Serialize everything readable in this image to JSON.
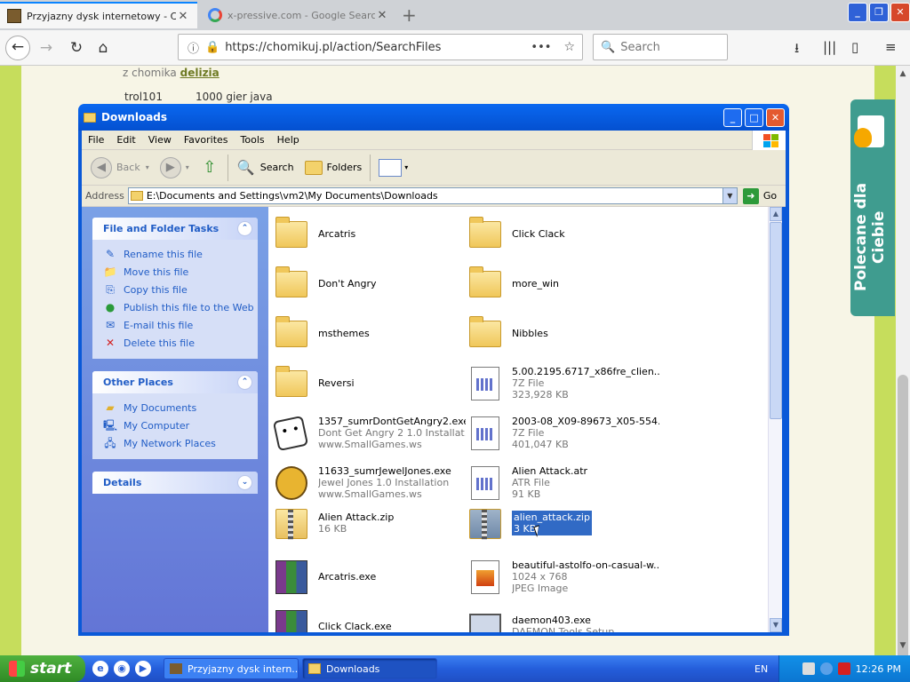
{
  "browser": {
    "tabs": [
      {
        "label": "Przyjazny dysk internetowy - Chomikuj.pl",
        "active": true
      },
      {
        "label": "x-pressive.com - Google Search",
        "active": false
      }
    ],
    "url": "https://chomikuj.pl/action/SearchFiles",
    "search_placeholder": "Search"
  },
  "page": {
    "from_prefix": "z chomika",
    "from_user": "delizia",
    "row_user": "trol101",
    "row_folder": "1000 gier java",
    "polecane": "Polecane dla Ciebie"
  },
  "explorer": {
    "title": "Downloads",
    "menu": [
      "File",
      "Edit",
      "View",
      "Favorites",
      "Tools",
      "Help"
    ],
    "toolbar": {
      "back": "Back",
      "search": "Search",
      "folders": "Folders"
    },
    "address_label": "Address",
    "address": "E:\\Documents and Settings\\vm2\\My Documents\\Downloads",
    "go": "Go",
    "tasks": {
      "title": "File and Folder Tasks",
      "items": [
        "Rename this file",
        "Move this file",
        "Copy this file",
        "Publish this file to the Web",
        "E-mail this file",
        "Delete this file"
      ]
    },
    "other_places": {
      "title": "Other Places",
      "items": [
        "My Documents",
        "My Computer",
        "My Network Places"
      ]
    },
    "details_title": "Details",
    "files": [
      {
        "name": "Arcatris",
        "l2": "",
        "l3": "",
        "icon": "folder"
      },
      {
        "name": "Click Clack",
        "l2": "",
        "l3": "",
        "icon": "folder"
      },
      {
        "name": "Don't Angry",
        "l2": "",
        "l3": "",
        "icon": "folder"
      },
      {
        "name": "more_win",
        "l2": "",
        "l3": "",
        "icon": "folder"
      },
      {
        "name": "msthemes",
        "l2": "",
        "l3": "",
        "icon": "folder"
      },
      {
        "name": "Nibbles",
        "l2": "",
        "l3": "",
        "icon": "folder"
      },
      {
        "name": "Reversi",
        "l2": "",
        "l3": "",
        "icon": "folder"
      },
      {
        "name": "5.00.2195.6717_x86fre_clien...",
        "l2": "7Z File",
        "l3": "323,928 KB",
        "icon": "file"
      },
      {
        "name": "1357_sumrDontGetAngry2.exe",
        "l2": "Dont Get Angry 2 1.0 Installat...",
        "l3": "www.SmallGames.ws",
        "icon": "dice"
      },
      {
        "name": "2003-08_X09-89673_X05-554...",
        "l2": "7Z File",
        "l3": "401,047 KB",
        "icon": "file"
      },
      {
        "name": "11633_sumrJewelJones.exe",
        "l2": "Jewel Jones 1.0 Installation",
        "l3": "www.SmallGames.ws",
        "icon": "face"
      },
      {
        "name": "Alien Attack.atr",
        "l2": "ATR File",
        "l3": "91 KB",
        "icon": "file"
      },
      {
        "name": "Alien Attack.zip",
        "l2": "16 KB",
        "l3": "",
        "icon": "zip"
      },
      {
        "name": "alien_attack.zip",
        "l2": "3 KB",
        "l3": "",
        "icon": "zipsel",
        "selected": true
      },
      {
        "name": "Arcatris.exe",
        "l2": "",
        "l3": "",
        "icon": "rar"
      },
      {
        "name": "beautiful-astolfo-on-casual-w...",
        "l2": "1024 x 768",
        "l3": "JPEG Image",
        "icon": "jpg"
      },
      {
        "name": "Click Clack.exe",
        "l2": "",
        "l3": "",
        "icon": "rar"
      },
      {
        "name": "daemon403.exe",
        "l2": "DAEMON Tools Setup",
        "l3": "",
        "icon": "pc"
      }
    ]
  },
  "taskbar": {
    "start": "start",
    "tasks": [
      "Przyjazny dysk intern...",
      "Downloads"
    ],
    "lang": "EN",
    "clock": "12:26 PM"
  }
}
